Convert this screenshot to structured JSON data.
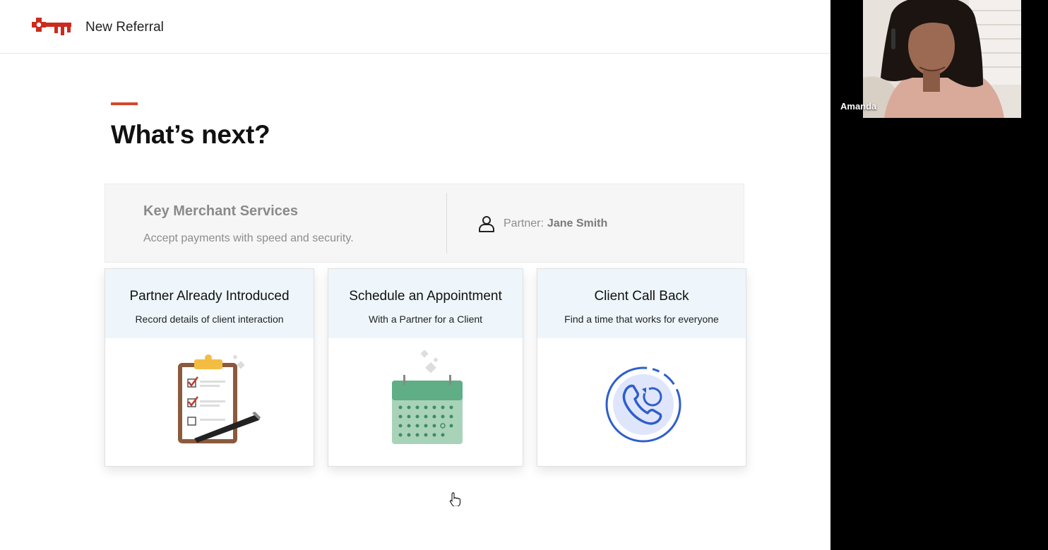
{
  "header": {
    "title": "New Referral",
    "logo": "keybank-key-logo"
  },
  "page": {
    "heading": "What’s next?"
  },
  "summary": {
    "service_name": "Key Merchant Services",
    "service_description": "Accept payments with speed and security.",
    "partner_label": "Partner:",
    "partner_name": "Jane Smith",
    "partner_icon": "user-icon"
  },
  "cards": [
    {
      "title": "Partner Already Introduced",
      "subtitle": "Record details of client interaction",
      "icon": "clipboard-checklist-icon"
    },
    {
      "title": "Schedule an Appointment",
      "subtitle": "With a Partner for a Client",
      "icon": "calendar-icon"
    },
    {
      "title": "Client Call Back",
      "subtitle": "Find a time that works for everyone",
      "icon": "phone-callback-icon"
    }
  ],
  "video_call": {
    "participant_name": "Amanda"
  },
  "colors": {
    "brand_red": "#cc2b1d",
    "accent_bar": "#d2492b",
    "card_header_bg": "#eef6fb",
    "calendar_green": "#5fae85",
    "phone_blue": "#2f5fc9"
  }
}
